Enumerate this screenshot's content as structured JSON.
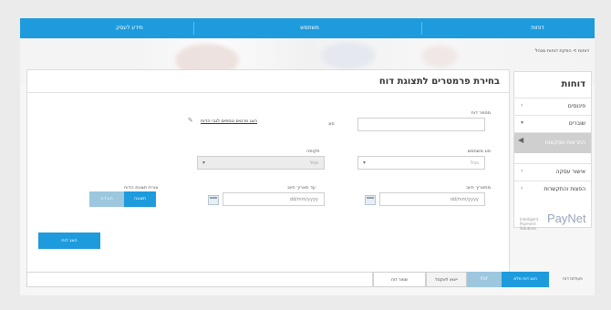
{
  "nav": {
    "tabs": [
      "דוחות",
      "משתמש",
      "מידע לעסק"
    ]
  },
  "breadcrumb": "דוחות > הפקת דוחות מנהל",
  "sidebar": {
    "title": "דוחות",
    "items": [
      {
        "label": "פיננסים"
      },
      {
        "label": "שוברים"
      },
      {
        "label": "התראות עסקאות"
      },
      {
        "label": "אישור עסקה"
      },
      {
        "label": "הפצות והתקשרות"
      }
    ]
  },
  "logo": {
    "brand": "PayNet",
    "small": "Intelligent Payment Solutions"
  },
  "main": {
    "heading": "בחירת פרמטרים לתצוגת דוח",
    "report_label": "מספר דוח",
    "type_label": "סוג",
    "link_text": "הצג פרטים נוספים לגבי הדוח",
    "status_label": "סוג משתמש",
    "status_value": "הכל",
    "period_label": "תקופה",
    "period_value": "הכל",
    "from_label": "מתאריך חיוב",
    "from_value": "dd/mm/yyyy",
    "to_label": "עד תאריך חיוב",
    "to_value": "dd/mm/yyyy",
    "toggle_label": "צורת תצוגת הדוח",
    "toggle_on": "תצוגה",
    "toggle_off": "הורדה",
    "submit": "הצג דוח"
  },
  "bottom": {
    "label": "פעולות דוח",
    "buttons": [
      "הצג דוח מלא",
      "PDF",
      "ייצוא לאקסל",
      "שמור דוח"
    ]
  }
}
